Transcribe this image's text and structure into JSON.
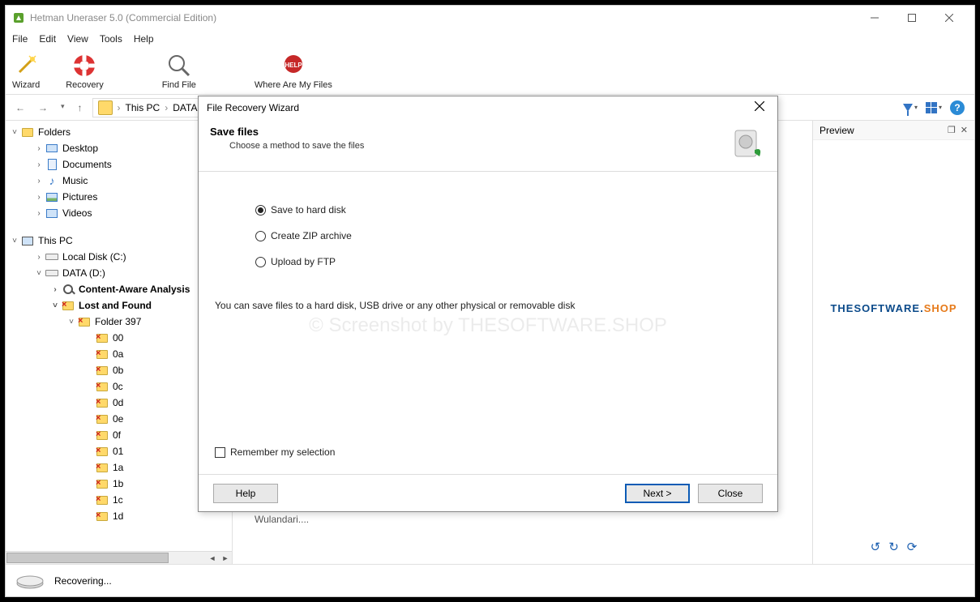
{
  "titlebar": {
    "title": "Hetman Uneraser 5.0 (Commercial Edition)"
  },
  "menubar": {
    "items": [
      "File",
      "Edit",
      "View",
      "Tools",
      "Help"
    ]
  },
  "toolbar": {
    "wizard": "Wizard",
    "recovery": "Recovery",
    "findfile": "Find File",
    "where": "Where Are My Files"
  },
  "breadcrumb": {
    "seg1": "This PC",
    "seg2": "DATA"
  },
  "tree": {
    "folders": "Folders",
    "desktop": "Desktop",
    "documents": "Documents",
    "music": "Music",
    "pictures": "Pictures",
    "videos": "Videos",
    "thispc": "This PC",
    "localdisk": "Local Disk (C:)",
    "data": "DATA (D:)",
    "content_aware": "Content-Aware Analysis",
    "lost_found": "Lost and Found",
    "folder397": "Folder 397",
    "sub": [
      "00",
      "0a",
      "0b",
      "0c",
      "0d",
      "0e",
      "0f",
      "01",
      "1a",
      "1b",
      "1c",
      "1d"
    ]
  },
  "preview": {
    "title": "Preview",
    "logo_a": "THESOFTWARE.",
    "logo_b": "SHOP"
  },
  "status": {
    "text": "Recovering..."
  },
  "wizard": {
    "title": "File Recovery Wizard",
    "heading": "Save files",
    "subheading": "Choose a method to save the files",
    "opt1": "Save to hard disk",
    "opt2": "Create ZIP archive",
    "opt3": "Upload by FTP",
    "desc": "You can save files to a hard disk, USB drive or any other physical or removable disk",
    "remember": "Remember my selection",
    "help": "Help",
    "next": "Next >",
    "close": "Close"
  },
  "watermark": "© Screenshot by THESOFTWARE.SHOP",
  "truncated": "Wulandari...."
}
